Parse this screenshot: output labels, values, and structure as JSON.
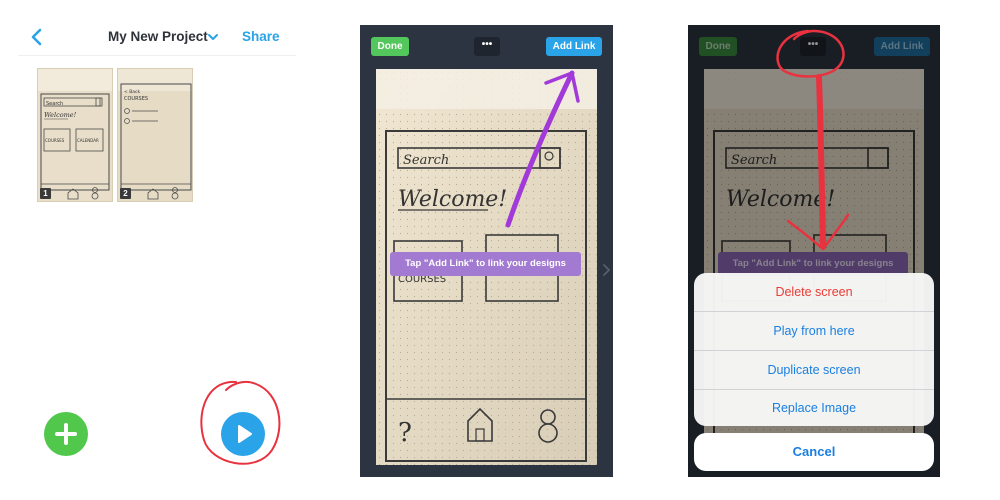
{
  "panel1": {
    "project_title": "My New Project",
    "share_label": "Share",
    "thumbnails": [
      {
        "number": "1"
      },
      {
        "number": "2"
      }
    ],
    "icons": {
      "back": "chevron-left-icon",
      "title_dropdown": "chevron-down-icon",
      "add": "plus-icon",
      "play": "play-icon"
    }
  },
  "panel2": {
    "done_label": "Done",
    "more_label": "•••",
    "add_link_label": "Add Link",
    "hint_text": "Tap \"Add Link\" to link your designs"
  },
  "panel3": {
    "done_label": "Done",
    "more_label": "•••",
    "add_link_label": "Add Link",
    "hint_text": "Tap \"Add Link\" to link your designs",
    "action_sheet": {
      "items": [
        "Delete screen",
        "Play from here",
        "Duplicate screen",
        "Replace Image"
      ],
      "cancel_label": "Cancel"
    }
  },
  "sketch": {
    "search_text": "Search",
    "welcome_text": "Welcome!",
    "courses_text": "COURSES",
    "calendar_text": "CALENDAR",
    "help_glyph": "?",
    "back_text": "< Back",
    "courses_heading": "COURSES"
  },
  "colors": {
    "brand_blue": "#2aa3e8",
    "add_green": "#51c84b",
    "done_green": "#54c75c",
    "hint_purple": "#a27ad2",
    "editor_bg": "#2b3440",
    "destructive_red": "#ec3b36",
    "ios_blue": "#1a7fe0",
    "annotation_red": "#e8323f",
    "annotation_purple": "#a13ad8",
    "paper": "#e7ddc8"
  }
}
